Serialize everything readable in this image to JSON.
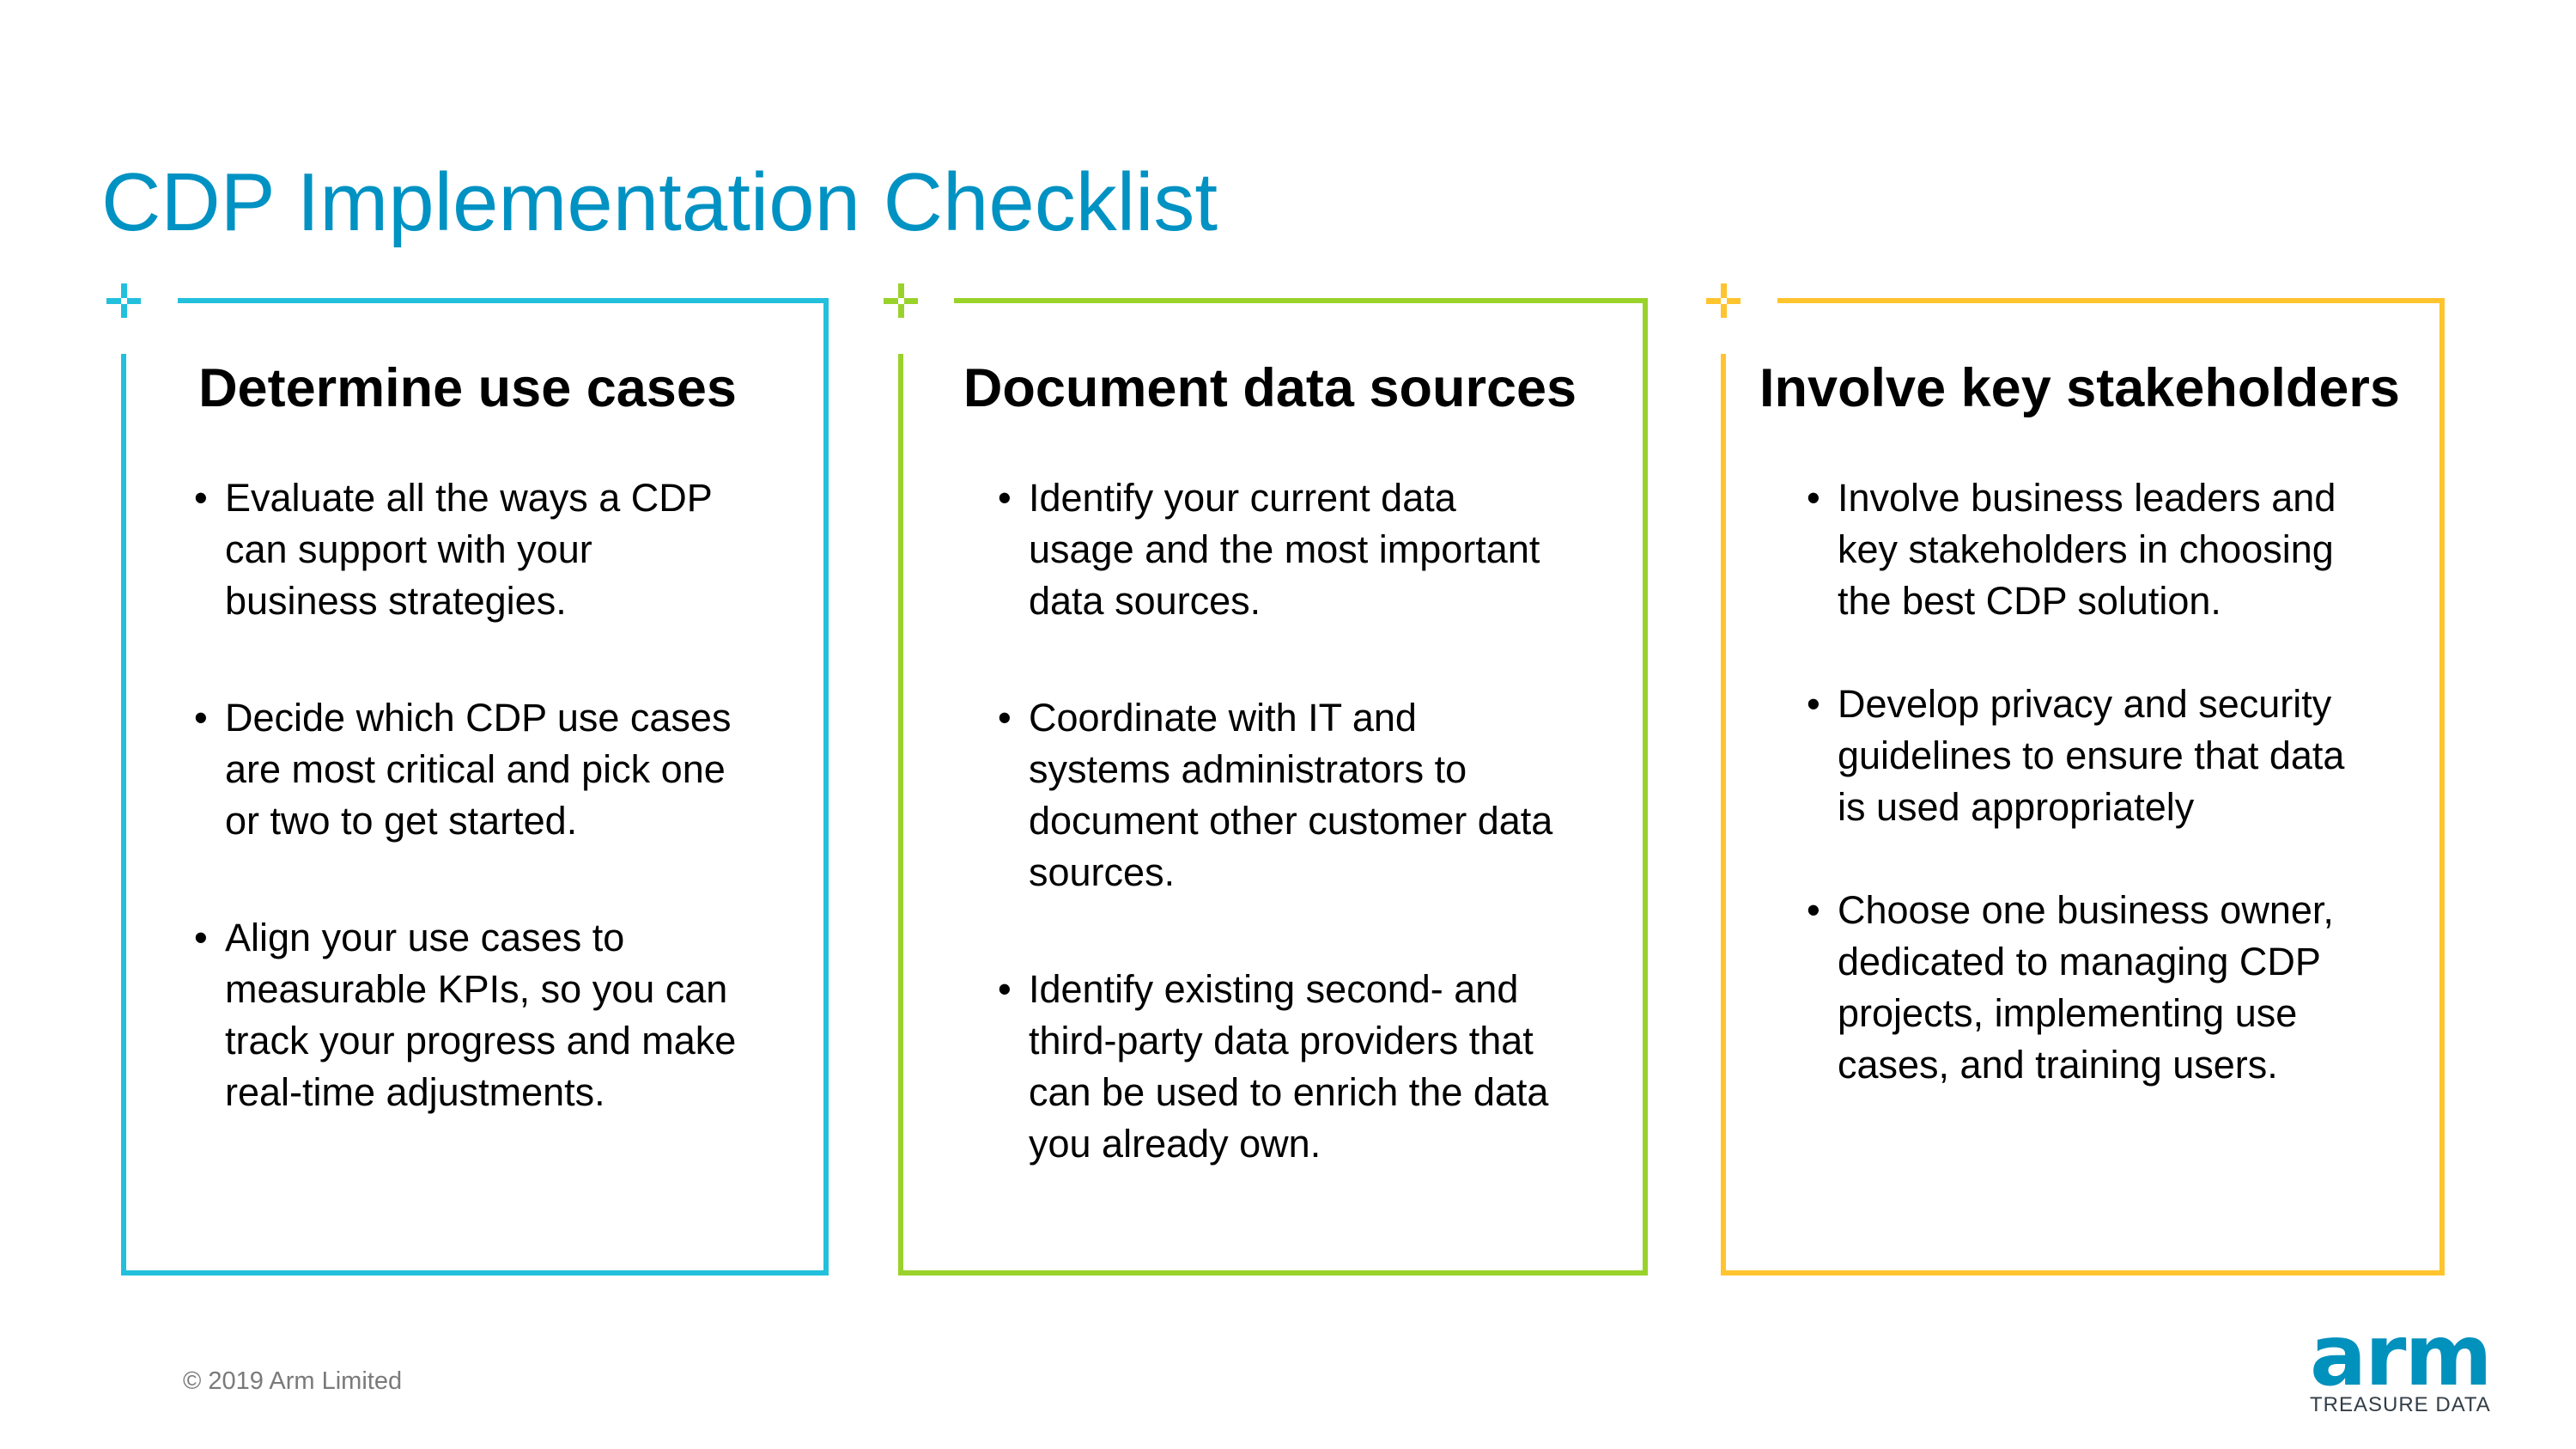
{
  "title": "CDP Implementation Checklist",
  "colors": {
    "title": "#0092C3",
    "card1": "#22C0DC",
    "card2": "#9AD22C",
    "card3": "#FFC42E",
    "logo": "#0091BD"
  },
  "cards": [
    {
      "heading": "Determine use cases",
      "bullets": [
        "Evaluate all the ways a CDP can support with your business strategies.",
        "Decide which CDP use cases are most critical and pick one or two to get started.",
        "Align your use cases to measurable KPIs, so you can track your progress and make real-time adjustments."
      ]
    },
    {
      "heading": "Document data sources",
      "bullets": [
        "Identify your current data usage and the most important data sources.",
        "Coordinate with IT and systems administrators to document other customer data sources.",
        "Identify existing second- and third-party data providers that can be used to enrich the data you already own."
      ]
    },
    {
      "heading": "Involve key stakeholders",
      "bullets": [
        "Involve business leaders and key stakeholders in choosing the best CDP solution.",
        "Develop privacy and security guidelines to ensure that data is used appropriately",
        "Choose one business owner, dedicated to managing CDP projects, implementing use cases, and training users."
      ]
    }
  ],
  "bullet_glyph": "•",
  "footer": "© 2019 Arm Limited",
  "logo": {
    "wordmark": "arm",
    "subtitle": "TREASURE DATA"
  }
}
